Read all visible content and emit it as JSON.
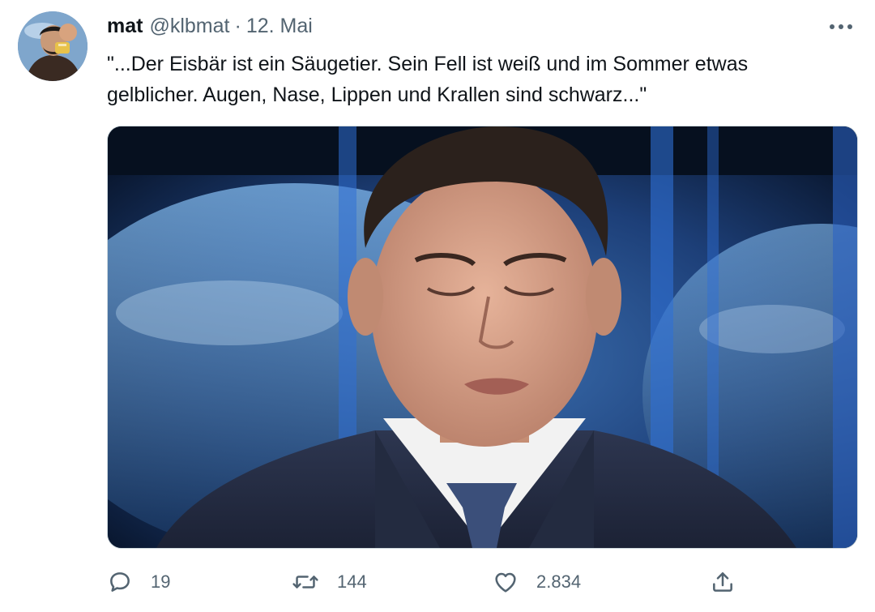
{
  "tweet": {
    "author": {
      "display_name": "mat",
      "handle": "@klbmat",
      "avatar_icon": "user-avatar"
    },
    "separator": "·",
    "date": "12. Mai",
    "more_icon": "more-dots-icon",
    "text_lines": [
      "\"...Der Eisbär ist ein Säugetier. Sein Fell ist weiß und im Sommer etwas",
      "gelblicher.  Augen, Nase, Lippen und Krallen sind schwarz...\""
    ],
    "media": {
      "type": "photo"
    },
    "actions": {
      "reply": {
        "icon": "reply-icon",
        "count": "19"
      },
      "retweet": {
        "icon": "retweet-icon",
        "count": "144"
      },
      "like": {
        "icon": "heart-icon",
        "count": "2.834"
      },
      "share": {
        "icon": "share-icon"
      }
    }
  },
  "colors": {
    "text_primary": "#0f1419",
    "text_secondary": "#536471",
    "border": "#cfd9de"
  }
}
